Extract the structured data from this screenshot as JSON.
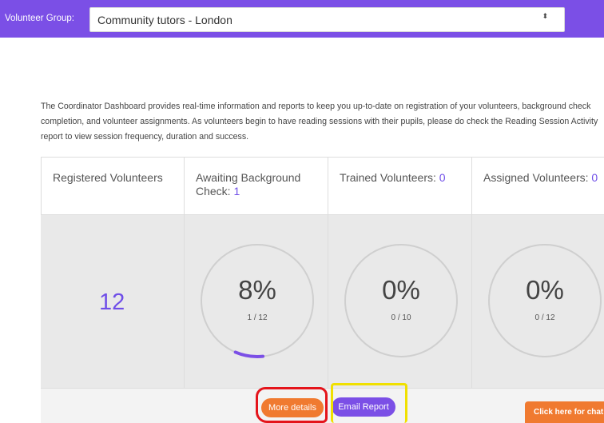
{
  "header": {
    "group_label": "Volunteer Group:",
    "group_value": "Community tutors - London",
    "select_arrows": "⬍"
  },
  "intro_text": "The Coordinator Dashboard provides real-time information and reports to keep you up-to-date on registration of your volunteers, background check completion, and volunteer assignments. As volunteers begin to have reading sessions with their pupils, please do check the Reading Session Activity report to view session frequency, duration and success.",
  "columns": [
    {
      "title": "Registered Volunteers",
      "count": ""
    },
    {
      "title": "Awaiting Background Check: ",
      "count": "1"
    },
    {
      "title": "Trained Volunteers: ",
      "count": "0"
    },
    {
      "title": "Assigned Volunteers: ",
      "count": "0"
    }
  ],
  "registered_total": "12",
  "gauges": [
    {
      "percent_label": "8%",
      "fraction": "1 / 12",
      "progress": 0.08
    },
    {
      "percent_label": "0%",
      "fraction": "0 / 10",
      "progress": 0
    },
    {
      "percent_label": "0%",
      "fraction": "0 / 12",
      "progress": 0
    }
  ],
  "buttons": {
    "more_details": "More details",
    "email_report": "Email Report",
    "chat": "Click here for chat"
  },
  "colors": {
    "brand_purple": "#7b4fe6",
    "accent_orange": "#f07a30",
    "highlight_red": "#e4141b",
    "highlight_yellow": "#f0e000"
  }
}
